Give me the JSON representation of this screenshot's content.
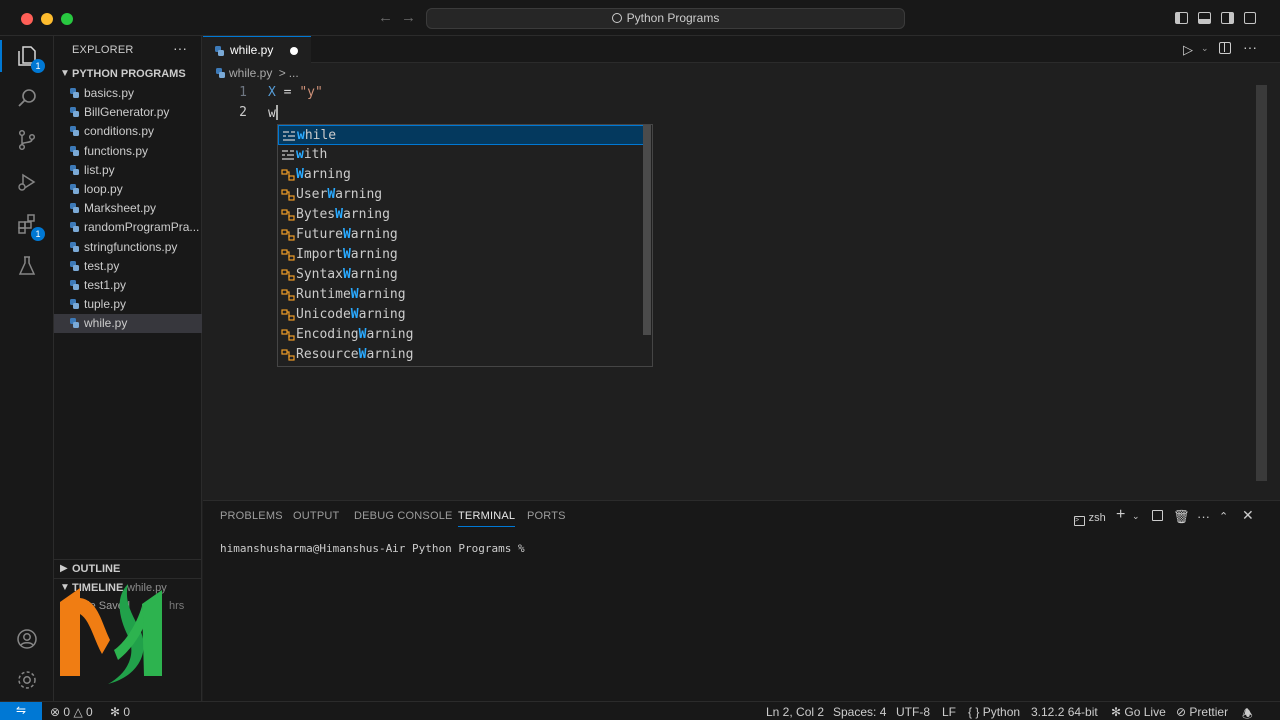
{
  "window": {
    "title": "Python Programs"
  },
  "colors": {
    "accent": "#0078d4",
    "keyword": "#569cd6",
    "string": "#ce9178",
    "match_highlight": "#2aaaff",
    "class_icon": "#ee9d28"
  },
  "activity_bar": {
    "explorer_badge": "1",
    "extensions_badge": "1",
    "icons": [
      "files-icon",
      "search-icon",
      "source-control-icon",
      "run-debug-icon",
      "extensions-icon",
      "testing-icon",
      "account-icon",
      "manage-gear-icon"
    ]
  },
  "sidebar": {
    "title": "EXPLORER",
    "more": "···",
    "folder": "PYTHON PROGRAMS",
    "files": [
      "basics.py",
      "BillGenerator.py",
      "conditions.py",
      "functions.py",
      "list.py",
      "loop.py",
      "Marksheet.py",
      "randomProgramPra...",
      "stringfunctions.py",
      "test.py",
      "test1.py",
      "tuple.py",
      "while.py"
    ],
    "selected_file": "while.py",
    "outline": "OUTLINE",
    "timeline": "TIMELINE",
    "timeline_file": "while.py",
    "timeline_entry": "File Saved",
    "timeline_age": "hrs"
  },
  "editor": {
    "tab": "while.py",
    "breadcrumb": {
      "file": "while.py",
      "sep": ">",
      "rest": "..."
    },
    "lines": [
      {
        "num": "1",
        "var": "X",
        "op": " = ",
        "str": "\"y\""
      },
      {
        "num": "2",
        "typed": "w"
      }
    ]
  },
  "suggest": {
    "items": [
      {
        "kind": "keyword",
        "match": "w",
        "rest": "hile",
        "pre": ""
      },
      {
        "kind": "keyword",
        "match": "w",
        "rest": "ith",
        "pre": ""
      },
      {
        "kind": "class",
        "match": "W",
        "rest": "arning",
        "pre": ""
      },
      {
        "kind": "class",
        "match": "W",
        "rest": "arning",
        "pre": "User"
      },
      {
        "kind": "class",
        "match": "W",
        "rest": "arning",
        "pre": "Bytes"
      },
      {
        "kind": "class",
        "match": "W",
        "rest": "arning",
        "pre": "Future"
      },
      {
        "kind": "class",
        "match": "W",
        "rest": "arning",
        "pre": "Import"
      },
      {
        "kind": "class",
        "match": "W",
        "rest": "arning",
        "pre": "Syntax"
      },
      {
        "kind": "class",
        "match": "W",
        "rest": "arning",
        "pre": "Runtime"
      },
      {
        "kind": "class",
        "match": "W",
        "rest": "arning",
        "pre": "Unicode"
      },
      {
        "kind": "class",
        "match": "W",
        "rest": "arning",
        "pre": "Encoding"
      },
      {
        "kind": "class",
        "match": "W",
        "rest": "arning",
        "pre": "Resource"
      }
    ]
  },
  "panel": {
    "tabs": [
      "PROBLEMS",
      "OUTPUT",
      "DEBUG CONSOLE",
      "TERMINAL",
      "PORTS"
    ],
    "active_tab": "TERMINAL",
    "shell": "zsh",
    "prompt": "himanshusharma@Himanshus-Air Python Programs %"
  },
  "status": {
    "errors": "0",
    "warnings": "0",
    "ports": "0",
    "position": "Ln 2, Col 2",
    "spaces": "Spaces: 4",
    "encoding": "UTF-8",
    "eol": "LF",
    "language": "Python",
    "interpreter": "3.12.2 64-bit",
    "golive": "Go Live",
    "prettier": "Prettier"
  }
}
